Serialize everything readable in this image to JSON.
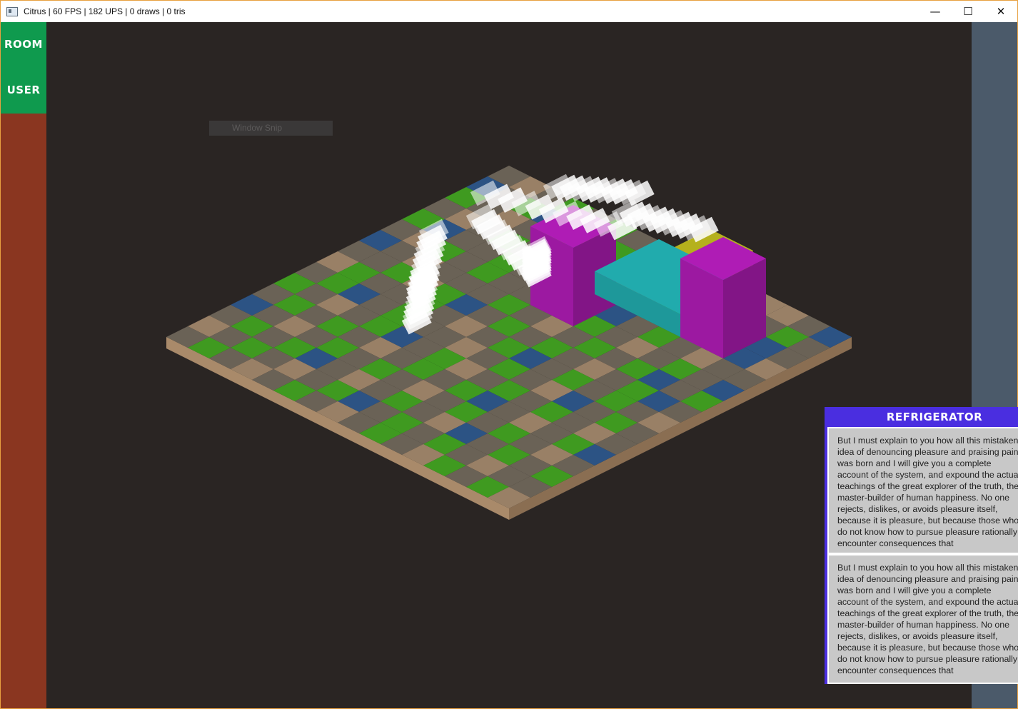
{
  "window": {
    "title": "Citrus | 60 FPS | 182 UPS | 0 draws | 0 tris",
    "controls": {
      "minimize": "—",
      "maximize": "☐",
      "close": "✕"
    }
  },
  "sidebar": {
    "room_label": "ROOM",
    "user_label": "USER"
  },
  "overlay": {
    "snip_label": "Window Snip"
  },
  "panel": {
    "title": "REFRIGERATOR",
    "entries": [
      {
        "text": "But I must explain to you how all this mistaken idea of denouncing pleasure and praising pain was born and I will give you a complete account of the system, and expound the actual teachings of the great explorer of the truth, the master-builder of human happiness. No one rejects, dislikes, or avoids pleasure itself, because it is pleasure, but because those who do not know how to pursue pleasure rationally encounter consequences that"
      },
      {
        "text": "But I must explain to you how all this mistaken idea of denouncing pleasure and praising pain was born and I will give you a complete account of the system, and expound the actual teachings of the great explorer of the truth, the master-builder of human happiness. No one rejects, dislikes, or avoids pleasure itself, because it is pleasure, but because those who do not know how to pursue pleasure rationally encounter consequences that"
      }
    ]
  },
  "colors": {
    "background": "#2a2523",
    "room_accent": "#0f9a4e",
    "sidebar": "#8a3620",
    "right_strip": "#4b5a6a",
    "panel_header": "#4a2ee0",
    "grass": "#3f9a20",
    "water": "#2c5384",
    "dirt": "#998066",
    "stone": "#6a6256",
    "magenta_block": "#a21aa8",
    "cyan_block": "#1f9ea0",
    "yellow_block": "#a8a41a"
  },
  "scene": {
    "tile_palette": {
      "g": "grass",
      "w": "water",
      "d": "dirt",
      "s": "stone"
    },
    "tile_rows": [
      "sdsgsgsswsssddsw",
      "wsgwsdgsgsdswsgs",
      "gsdsgwsddsgsdsws",
      "sdsgsgwsgsgsdswd",
      "gwssgsgsdwsgsdss",
      "sdgsgssgsgsdsgsw",
      "wsdsssgsdsgsgwsg",
      "ssgdgwsgsgsdsgws",
      "dgssgsdsgwsgsgsd",
      "sgwsgssdsgsdwsgs",
      "gsdsgwsgdsgsgsds",
      "sgsgsdsgsgwsdsgw",
      "wsdsgsgsdsgsgsds",
      "sgsgwsdsgsdwsgsg",
      "dsgsdsgwsgsgsdss",
      "sgsdsgsdsgsdgsgd"
    ]
  }
}
